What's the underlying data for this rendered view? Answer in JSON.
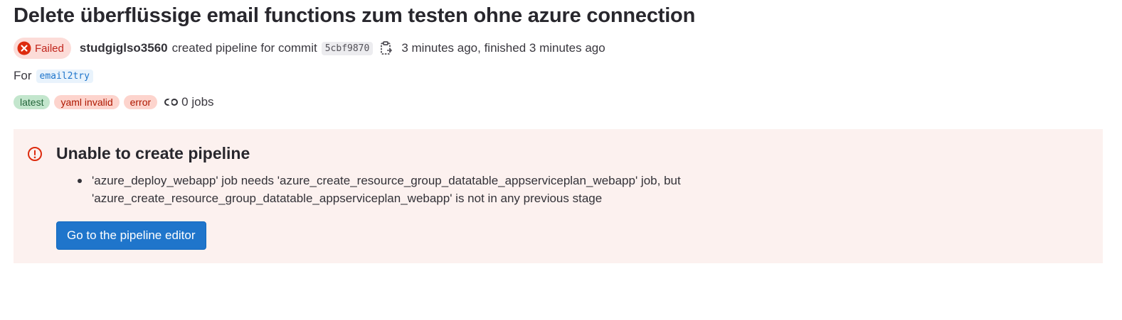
{
  "header": {
    "title": "Delete überflüssige email functions zum testen ohne azure connection"
  },
  "meta": {
    "status_label": "Failed",
    "author": "studgiglso3560",
    "action_text": "created pipeline for commit",
    "commit_sha": "5cbf9870",
    "time_text": "3 minutes ago, finished 3 minutes ago"
  },
  "ref": {
    "prefix": "For",
    "name": "email2try"
  },
  "badges": {
    "latest": "latest",
    "yaml_invalid": "yaml invalid",
    "error": "error",
    "jobs": "0 jobs"
  },
  "alert": {
    "title": "Unable to create pipeline",
    "messages": [
      "'azure_deploy_webapp' job needs 'azure_create_resource_group_datatable_appserviceplan_webapp' job, but 'azure_create_resource_group_datatable_appserviceplan_webapp' is not in any previous stage"
    ],
    "button_label": "Go to the pipeline editor"
  },
  "colors": {
    "danger": "#dd2b0e",
    "accent": "#1f75cb",
    "alert_bg": "#fcf1ef"
  }
}
